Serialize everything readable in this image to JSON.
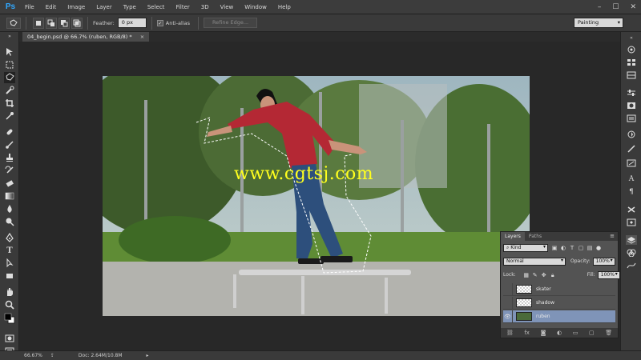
{
  "app": {
    "logo": "Ps",
    "menu": [
      "File",
      "Edit",
      "Image",
      "Layer",
      "Type",
      "Select",
      "Filter",
      "3D",
      "View",
      "Window",
      "Help"
    ],
    "window_controls": [
      "–",
      "☐",
      "✕"
    ]
  },
  "options": {
    "feather_label": "Feather:",
    "feather_value": "0 px",
    "antialias_label": "Anti-alias",
    "antialias_checked": true,
    "refine_edge_label": "Refine Edge...",
    "workspace": "Painting"
  },
  "document": {
    "tab_title": "04_begin.psd @ 66.7% (ruben, RGB/8) *",
    "close": "×"
  },
  "watermark": "www.cgtsj.com",
  "layers_panel": {
    "tabs": [
      "Layers",
      "Paths"
    ],
    "active_tab": "Layers",
    "filter_kind": "Kind",
    "blend_mode": "Normal",
    "opacity_label": "Opacity:",
    "opacity_value": "100%",
    "lock_label": "Lock:",
    "fill_label": "Fill:",
    "fill_value": "100%",
    "layers": [
      {
        "name": "skater",
        "visible": false,
        "selected": false
      },
      {
        "name": "shadow",
        "visible": false,
        "selected": false
      },
      {
        "name": "ruben",
        "visible": true,
        "selected": true
      }
    ]
  },
  "status": {
    "zoom": "66.67%",
    "doc": "Doc: 2.64M/10.8M"
  },
  "colors": {
    "brand": "#31a8ff",
    "watermark": "#ffff1e",
    "selected_layer": "#7f94b8",
    "ui_dark": "#282828",
    "ui_panel": "#3a3a3a"
  }
}
